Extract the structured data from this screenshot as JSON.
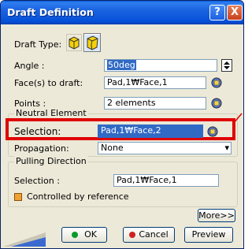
{
  "window": {
    "title": "Draft Definition",
    "help": "?",
    "close": "X"
  },
  "draft_type": {
    "label": "Draft Type:"
  },
  "angle": {
    "label": "Angle :",
    "value": "50deg"
  },
  "faces": {
    "label": "Face(s) to draft:",
    "value": "Pad,1₩Face,1"
  },
  "points": {
    "label": "Points :",
    "value": "2 elements"
  },
  "neutral": {
    "group_label": "Neutral Element",
    "selection_label": "Selection:",
    "selection_value": "Pad,1₩Face,2",
    "propagation_label": "Propagation:",
    "propagation_value": "None"
  },
  "pulling": {
    "group_label": "Pulling Direction",
    "selection_label": "Selection :",
    "selection_value": "Pad,1₩Face,1",
    "controlled_label": "Controlled by reference"
  },
  "buttons": {
    "more": "More>>",
    "ok": "OK",
    "cancel": "Cancel",
    "preview": "Preview"
  },
  "colors": {
    "titlebar": "#0a5fd8",
    "highlight_box": "#e00000",
    "selection_bg": "#316ac5",
    "dialog_bg": "#ece9d8"
  },
  "icons": {
    "draft_type_1": "draft-constant-icon",
    "draft_type_2": "draft-variable-icon",
    "selector": "selector-icon",
    "spinner": "spinner-icon",
    "checkbox": "orange-checkbox-icon",
    "ok": "green-dot-icon",
    "cancel": "red-dot-icon"
  }
}
